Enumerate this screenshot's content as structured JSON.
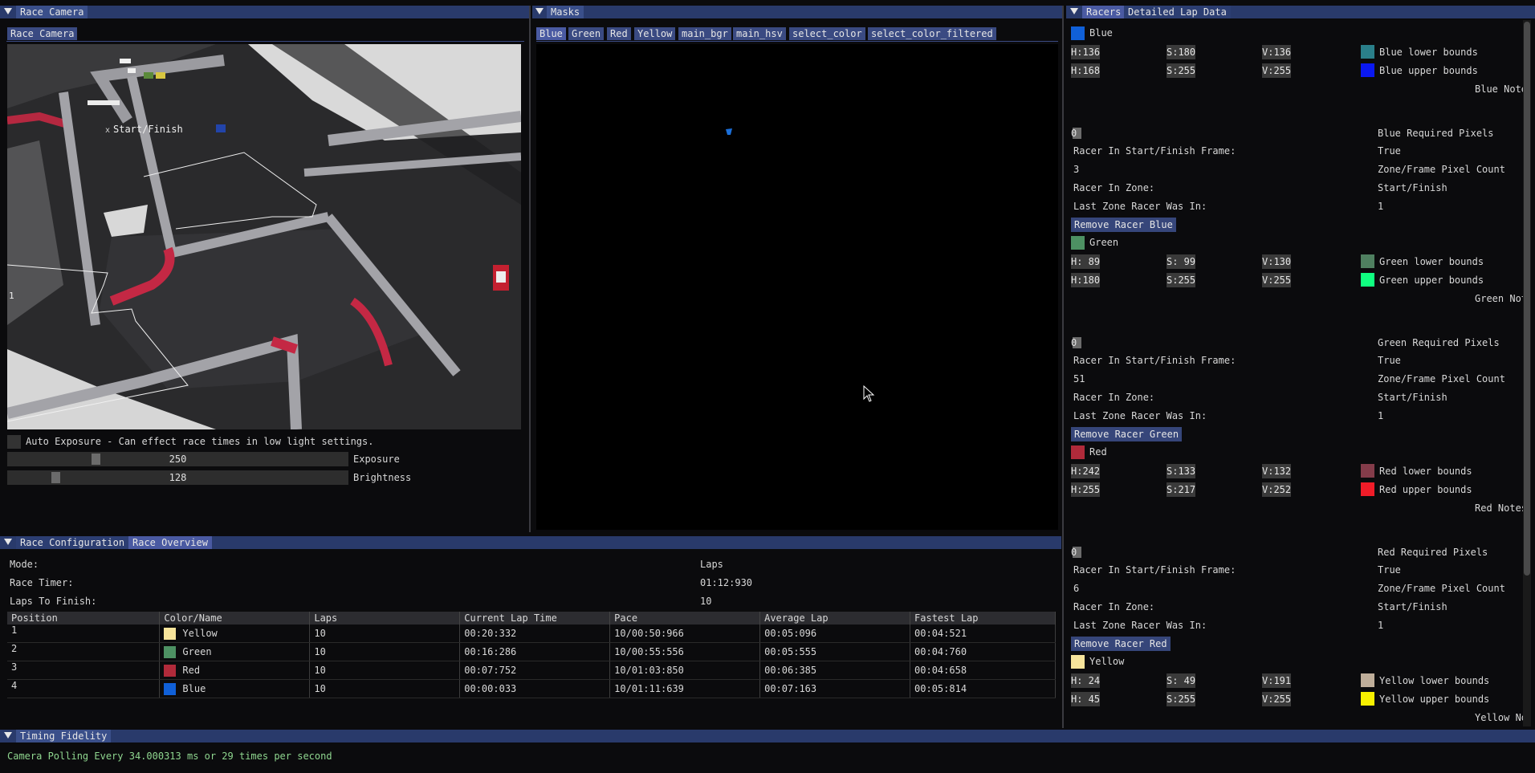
{
  "colors": {
    "blue": "#1060d8",
    "green": "#4d9163",
    "red": "#b02a3a",
    "yellow": "#f7e49b"
  },
  "race_camera": {
    "window_title": "Race Camera",
    "tab_label": "Race Camera",
    "zone_start_label": "Start/Finish",
    "zone_one_label": "1",
    "auto_exposure_label": "Auto Exposure - Can effect race times in low light settings.",
    "exposure": {
      "value": "250",
      "label": "Exposure",
      "level": 0.25
    },
    "brightness": {
      "value": "128",
      "label": "Brightness",
      "level": 0.13
    }
  },
  "masks": {
    "window_title": "Masks",
    "tabs": [
      "Blue",
      "Green",
      "Red",
      "Yellow",
      "main_bgr",
      "main_hsv",
      "select_color",
      "select_color_filtered"
    ]
  },
  "racers_panel": {
    "tabs": [
      "Racers",
      "Detailed Lap Data"
    ],
    "racers": [
      {
        "name": "Blue",
        "swatch": "#1060d8",
        "lower": {
          "h": "H:136",
          "s": "S:180",
          "v": "V:136",
          "swatch": "#2a7f8a",
          "label": "Blue lower bounds"
        },
        "upper": {
          "h": "H:168",
          "s": "S:255",
          "v": "V:255",
          "swatch": "#0a18f0",
          "label": "Blue upper bounds"
        },
        "notes_label": "Blue Note",
        "required_value": "0",
        "required_label": "Blue Required Pixels",
        "start_frame_label": "Racer In Start/Finish Frame:",
        "start_frame_value": "True",
        "pixel_count": "3",
        "pixel_count_label": "Zone/Frame Pixel Count",
        "in_zone_label": "Racer In Zone:",
        "in_zone_value": "Start/Finish",
        "last_zone_label": "Last Zone Racer Was In:",
        "last_zone_value": "1",
        "remove_label": "Remove Racer Blue"
      },
      {
        "name": "Green",
        "swatch": "#4d9163",
        "lower": {
          "h": "H: 89",
          "s": "S: 99",
          "v": "V:130",
          "swatch": "#4f8060",
          "label": "Green lower bounds"
        },
        "upper": {
          "h": "H:180",
          "s": "S:255",
          "v": "V:255",
          "swatch": "#10ff80",
          "label": "Green upper bounds"
        },
        "notes_label": "Green Not",
        "required_value": "0",
        "required_label": "Green Required Pixels",
        "start_frame_label": "Racer In Start/Finish Frame:",
        "start_frame_value": "True",
        "pixel_count": "51",
        "pixel_count_label": "Zone/Frame Pixel Count",
        "in_zone_label": "Racer In Zone:",
        "in_zone_value": "Start/Finish",
        "last_zone_label": "Last Zone Racer Was In:",
        "last_zone_value": "1",
        "remove_label": "Remove Racer Green"
      },
      {
        "name": "Red",
        "swatch": "#b02a3a",
        "lower": {
          "h": "H:242",
          "s": "S:133",
          "v": "V:132",
          "swatch": "#843c4a",
          "label": "Red lower bounds"
        },
        "upper": {
          "h": "H:255",
          "s": "S:217",
          "v": "V:252",
          "swatch": "#f01c28",
          "label": "Red upper bounds"
        },
        "notes_label": "Red Notes",
        "required_value": "0",
        "required_label": "Red Required Pixels",
        "start_frame_label": "Racer In Start/Finish Frame:",
        "start_frame_value": "True",
        "pixel_count": "6",
        "pixel_count_label": "Zone/Frame Pixel Count",
        "in_zone_label": "Racer In Zone:",
        "in_zone_value": "Start/Finish",
        "last_zone_label": "Last Zone Racer Was In:",
        "last_zone_value": "1",
        "remove_label": "Remove Racer Red"
      },
      {
        "name": "Yellow",
        "swatch": "#f7e49b",
        "lower": {
          "h": "H: 24",
          "s": "S: 49",
          "v": "V:191",
          "swatch": "#bfae9a",
          "label": "Yellow lower bounds"
        },
        "upper": {
          "h": "H: 45",
          "s": "S:255",
          "v": "V:255",
          "swatch": "#f8f000",
          "label": "Yellow upper bounds"
        },
        "notes_label": "Yellow No"
      }
    ]
  },
  "race_config": {
    "tabs": [
      "Race Configuration",
      "Race Overview"
    ],
    "mode_label": "Mode:",
    "mode_value": "Laps",
    "timer_label": "Race Timer:",
    "timer_value": "01:12:930",
    "laps_label": "Laps To Finish:",
    "laps_value": "10",
    "columns": [
      "Position",
      "Color/Name",
      "Laps",
      "Current Lap Time",
      "Pace",
      "Average Lap",
      "Fastest Lap"
    ],
    "rows": [
      {
        "position": "1",
        "swatch": "#f7e49b",
        "name": "Yellow",
        "laps": "10",
        "current": "00:20:332",
        "pace": "10/00:50:966",
        "average": "00:05:096",
        "fastest": "00:04:521"
      },
      {
        "position": "2",
        "swatch": "#4d9163",
        "name": "Green",
        "laps": "10",
        "current": "00:16:286",
        "pace": "10/00:55:556",
        "average": "00:05:555",
        "fastest": "00:04:760"
      },
      {
        "position": "3",
        "swatch": "#b02a3a",
        "name": "Red",
        "laps": "10",
        "current": "00:07:752",
        "pace": "10/01:03:850",
        "average": "00:06:385",
        "fastest": "00:04:658"
      },
      {
        "position": "4",
        "swatch": "#1060d8",
        "name": "Blue",
        "laps": "10",
        "current": "00:00:033",
        "pace": "10/01:11:639",
        "average": "00:07:163",
        "fastest": "00:05:814"
      }
    ]
  },
  "timing": {
    "window_title": "Timing Fidelity",
    "status": "Camera Polling Every 34.000313 ms or 29 times per second"
  }
}
